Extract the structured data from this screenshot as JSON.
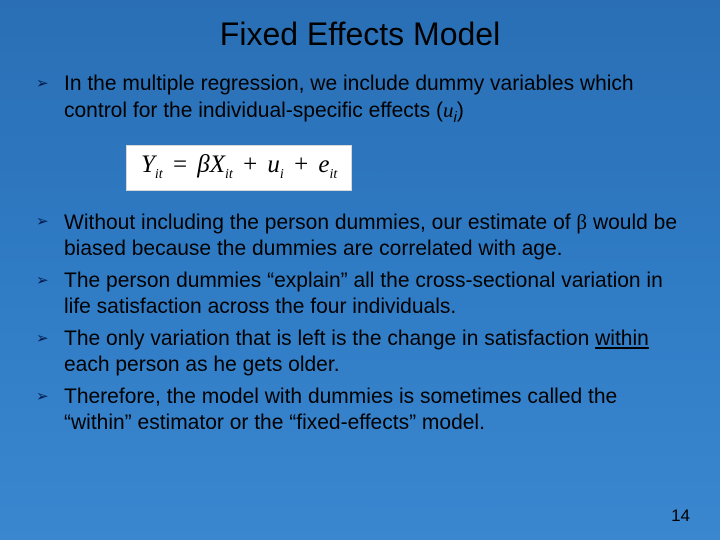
{
  "title": "Fixed Effects Model",
  "bullets": {
    "b1_a": "In the multiple regression, we include dummy variables which control for the individual-specific effects (",
    "b1_var": "u",
    "b1_sub": "i",
    "b1_b": ")",
    "b2_a": "Without including the person dummies, our estimate of ",
    "b2_beta": "β",
    "b2_b": " would be biased because the dummies are correlated with age.",
    "b3": "The person dummies “explain” all the cross-sectional variation in life satisfaction across the four individuals.",
    "b4_a": "The only variation that is left is the change in satisfaction ",
    "b4_u": "within",
    "b4_b": " each person as he gets older.",
    "b5": "Therefore, the model with dummies is sometimes called the “within” estimator or the “fixed-effects” model."
  },
  "equation": {
    "Y": "Y",
    "it1": "it",
    "eq": "=",
    "beta": "β",
    "X": "X",
    "it2": "it",
    "plus1": "+",
    "u": "u",
    "i": "i",
    "plus2": "+",
    "e": "e",
    "it3": "it"
  },
  "bullet_glyph": "➢",
  "page_number": "14"
}
